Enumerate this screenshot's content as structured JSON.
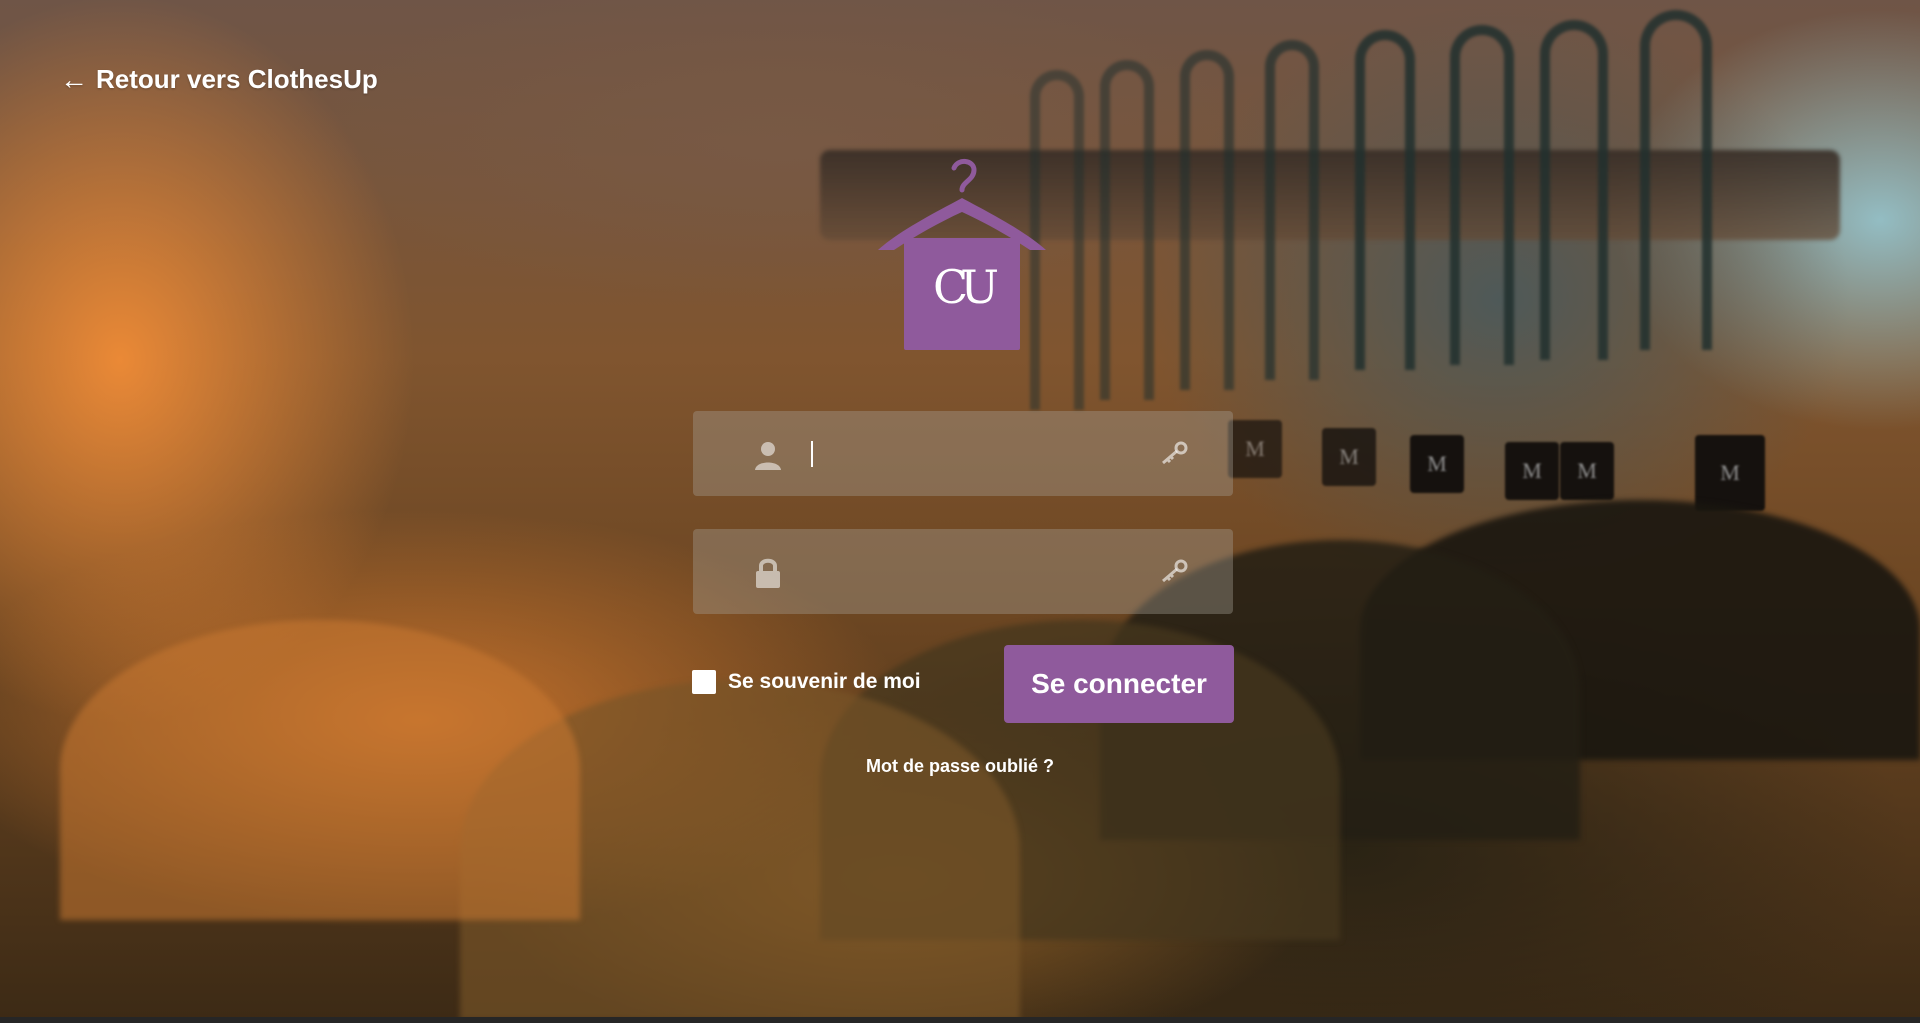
{
  "back_link": {
    "arrow": "←",
    "label": "Retour vers ClothesUp"
  },
  "logo": {
    "monogram": "CU",
    "icon": "hanger-icon",
    "color": "#8f5a9c"
  },
  "login_form": {
    "username": {
      "value": "",
      "placeholder": "",
      "icon": "user-icon",
      "trailing_icon": "key-icon"
    },
    "password": {
      "value": "",
      "placeholder": "",
      "icon": "lock-icon",
      "trailing_icon": "key-icon"
    },
    "remember_label": "Se souvenir de moi",
    "remember_checked": false,
    "submit_label": "Se connecter",
    "forgot_label": "Mot de passe oublié ?"
  },
  "background": {
    "tag_letter": "M"
  },
  "colors": {
    "accent": "#8f5a9c",
    "text": "#ffffff"
  }
}
